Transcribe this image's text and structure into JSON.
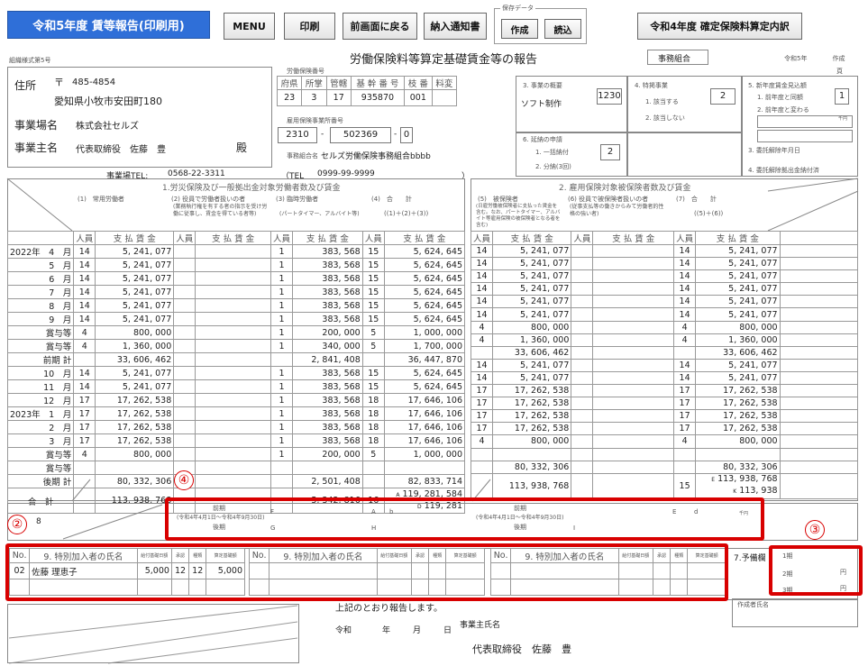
{
  "toolbar": {
    "title": "令和5年度 賃等報告(印刷用)",
    "menu": "MENU",
    "print": "印刷",
    "back": "前画面に戻る",
    "notice": "納入通知書",
    "save_group": "保存データ",
    "create": "作成",
    "load": "読込",
    "prev_year": "令和4年度 確定保険料算定内訳"
  },
  "header": {
    "form_no": "組織様式第5号",
    "doc_title": "労働保険料等算定基礎賃金等の報告",
    "jimu_kumiai": "事務組合",
    "created": "令和5年　　　　作成",
    "page": "頁"
  },
  "address": {
    "label_addr": "住所",
    "postal_mark": "〒",
    "postal": "485-4854",
    "addr": "愛知県小牧市安田町180",
    "label_office": "事業場名",
    "office": "株式会社セルズ",
    "label_owner": "事業主名",
    "owner": "代表取締役　佐藤　豊",
    "dono": "殿",
    "tel_label": "事業場TEL:",
    "tel": "0568-22-3311"
  },
  "insurance": {
    "label": "労働保険番号",
    "headers": [
      "府県",
      "所掌",
      "管轄",
      "基 幹 番 号",
      "枝 番",
      "",
      "番",
      "料変"
    ],
    "values": [
      "23",
      "3",
      "17",
      "935870",
      "001",
      "",
      "",
      ""
    ],
    "emp_label": "雇用保険事業所番号",
    "emp1": "2310",
    "emp2": "502369",
    "emp3": "0",
    "union_label": "事務組合名",
    "union": "セルズ労働保険事務組合bbbb",
    "tel_open": "（TEL",
    "union_tel": "0999-99-9999",
    "tel_close": "）"
  },
  "summary": {
    "gaiyo_label": "3. 事業の概要",
    "gaiyo_text": "ソフト制作",
    "gaiyo_code": "1230",
    "tokusho_label": "4. 特掲事業",
    "tokusho_1": "1. 該当する",
    "tokusho_2": "2. 該当しない",
    "tokusho_val": "2",
    "shinnen_label": "5. 新年度賃金見込額",
    "shinnen_1": "1. 前年度と同額",
    "shinnen_2": "2. 前年度と変わる",
    "shinnen_val": "1",
    "yen": "千円",
    "enno_label": "6. 延納の申請",
    "enno_1": "1. 一括納付",
    "enno_2": "2. 分納(3回)",
    "enno_val": "2",
    "kaijo_label": "3. 委託解除年月日",
    "kaijo2_label": "4. 委託解除拠出金納付済"
  },
  "section_left_title": "1.労災保険及び一般拠出金対象労働者数及び賃金",
  "section_right_title": "2. 雇用保険対象被保険者数及び賃金",
  "columns": {
    "c1": "(1)　常用労働者",
    "c2": "(2) 役員で労働者扱いの者",
    "c2sub": "(業務執行権を有する者の指示を受け労働に従事し、賃金を得ている者等)",
    "c3": "(3) 臨時労働者",
    "c3sub": "(パートタイマー、アルバイト等)",
    "c4": "(4)　合　　計",
    "c4sub": "((1)＋(2)＋(3))",
    "c5": "(5)　被保険者",
    "c5sub": "(日雇労働被保険者に支払った賃金を含む。なお、パートタイマー、アルバイト等雇用保険の被保険者となる者を含む)",
    "c6": "(6) 役員で被保険者扱いの者",
    "c6sub": "(従事支払等の働きからみて労働者的性格の強い者)",
    "c7": "(7)　合　　計",
    "c7sub": "((5)＋(6))",
    "ninzu": "人員",
    "shiharai": "支 払 賃 金",
    "yen_unit": "円"
  },
  "rows": [
    {
      "label": "2022年　4　月",
      "c1n": "14",
      "c1": "5, 241, 077",
      "c3n": "1",
      "c3": "383, 568",
      "c4n": "15",
      "c4": "5, 624, 645",
      "c5n": "14",
      "c5": "5, 241, 077",
      "c7n": "14",
      "c7": "5, 241, 077"
    },
    {
      "label": "5　月",
      "c1n": "14",
      "c1": "5, 241, 077",
      "c3n": "1",
      "c3": "383, 568",
      "c4n": "15",
      "c4": "5, 624, 645",
      "c5n": "14",
      "c5": "5, 241, 077",
      "c7n": "14",
      "c7": "5, 241, 077"
    },
    {
      "label": "6　月",
      "c1n": "14",
      "c1": "5, 241, 077",
      "c3n": "1",
      "c3": "383, 568",
      "c4n": "15",
      "c4": "5, 624, 645",
      "c5n": "14",
      "c5": "5, 241, 077",
      "c7n": "14",
      "c7": "5, 241, 077"
    },
    {
      "label": "7　月",
      "c1n": "14",
      "c1": "5, 241, 077",
      "c3n": "1",
      "c3": "383, 568",
      "c4n": "15",
      "c4": "5, 624, 645",
      "c5n": "14",
      "c5": "5, 241, 077",
      "c7n": "14",
      "c7": "5, 241, 077"
    },
    {
      "label": "8　月",
      "c1n": "14",
      "c1": "5, 241, 077",
      "c3n": "1",
      "c3": "383, 568",
      "c4n": "15",
      "c4": "5, 624, 645",
      "c5n": "14",
      "c5": "5, 241, 077",
      "c7n": "14",
      "c7": "5, 241, 077"
    },
    {
      "label": "9　月",
      "c1n": "14",
      "c1": "5, 241, 077",
      "c3n": "1",
      "c3": "383, 568",
      "c4n": "15",
      "c4": "5, 624, 645",
      "c5n": "14",
      "c5": "5, 241, 077",
      "c7n": "14",
      "c7": "5, 241, 077"
    },
    {
      "label": "賞与等",
      "c1n": "4",
      "c1": "800, 000",
      "c3n": "1",
      "c3": "200, 000",
      "c4n": "5",
      "c4": "1, 000, 000",
      "c5n": "4",
      "c5": "800, 000",
      "c7n": "4",
      "c7": "800, 000"
    },
    {
      "label": "賞与等",
      "c1n": "4",
      "c1": "1, 360, 000",
      "c3n": "1",
      "c3": "340, 000",
      "c4n": "5",
      "c4": "1, 700, 000",
      "c5n": "4",
      "c5": "1, 360, 000",
      "c7n": "4",
      "c7": "1, 360, 000"
    },
    {
      "label": "前期 計",
      "c1n": "",
      "c1": "33, 606, 462",
      "c3n": "",
      "c3": "2, 841, 408",
      "c4n": "",
      "c4": "36, 447, 870",
      "c5n": "",
      "c5": "33, 606, 462",
      "c7n": "",
      "c7": "33, 606, 462"
    },
    {
      "label": "10　月",
      "c1n": "14",
      "c1": "5, 241, 077",
      "c3n": "1",
      "c3": "383, 568",
      "c4n": "15",
      "c4": "5, 624, 645",
      "c5n": "14",
      "c5": "5, 241, 077",
      "c7n": "14",
      "c7": "5, 241, 077"
    },
    {
      "label": "11　月",
      "c1n": "14",
      "c1": "5, 241, 077",
      "c3n": "1",
      "c3": "383, 568",
      "c4n": "15",
      "c4": "5, 624, 645",
      "c5n": "14",
      "c5": "5, 241, 077",
      "c7n": "14",
      "c7": "5, 241, 077"
    },
    {
      "label": "12　月",
      "c1n": "17",
      "c1": "17, 262, 538",
      "c3n": "1",
      "c3": "383, 568",
      "c4n": "18",
      "c4": "17, 646, 106",
      "c5n": "17",
      "c5": "17, 262, 538",
      "c7n": "17",
      "c7": "17, 262, 538"
    },
    {
      "label": "2023年　1　月",
      "c1n": "17",
      "c1": "17, 262, 538",
      "c3n": "1",
      "c3": "383, 568",
      "c4n": "18",
      "c4": "17, 646, 106",
      "c5n": "17",
      "c5": "17, 262, 538",
      "c7n": "17",
      "c7": "17, 262, 538"
    },
    {
      "label": "2　月",
      "c1n": "17",
      "c1": "17, 262, 538",
      "c3n": "1",
      "c3": "383, 568",
      "c4n": "18",
      "c4": "17, 646, 106",
      "c5n": "17",
      "c5": "17, 262, 538",
      "c7n": "17",
      "c7": "17, 262, 538"
    },
    {
      "label": "3　月",
      "c1n": "17",
      "c1": "17, 262, 538",
      "c3n": "1",
      "c3": "383, 568",
      "c4n": "18",
      "c4": "17, 646, 106",
      "c5n": "17",
      "c5": "17, 262, 538",
      "c7n": "17",
      "c7": "17, 262, 538"
    },
    {
      "label": "賞与等",
      "c1n": "4",
      "c1": "800, 000",
      "c3n": "1",
      "c3": "200, 000",
      "c4n": "5",
      "c4": "1, 000, 000",
      "c5n": "4",
      "c5": "800, 000",
      "c7n": "4",
      "c7": "800, 000"
    },
    {
      "label": "賞与等",
      "c1n": "",
      "c1": "",
      "c3n": "",
      "c3": "",
      "c4n": "",
      "c4": "",
      "c5n": "",
      "c5": "",
      "c7n": "",
      "c7": ""
    },
    {
      "label": "後期 計",
      "c1n": "",
      "c1": "80, 332, 306",
      "c3n": "",
      "c3": "2, 501, 408",
      "c4n": "",
      "c4": "82, 833, 714",
      "c5n": "",
      "c5": "80, 332, 306",
      "c7n": "",
      "c7": "80, 332, 306"
    }
  ],
  "totals": {
    "label": "合　計",
    "c1": "113, 938, 768",
    "c3": "5, 342, 816",
    "c4a_mark": "A",
    "c4a": "119, 281, 584",
    "c4b": "16",
    "c4b_mark": "D",
    "c4c": "119, 281",
    "c5": "113, 938, 768",
    "c7a_mark": "E",
    "c7a": "113, 938, 768",
    "c7b": "15",
    "c7b_mark": "K",
    "c7c": "113, 938"
  },
  "row8": {
    "label": "8",
    "zenki": "前期",
    "zenki_sub": "(令和4年4月1日～令和4年9月30日)",
    "koki": "後期",
    "zenki_r": "前期",
    "zenki_r_sub": "(令和4年4月1日～令和4年9月30日)",
    "koki_r": "後期",
    "mark_f": "F",
    "mark_a": "A",
    "mark_b": "b",
    "mark_g": "G",
    "mark_h": "H",
    "mark_i": "I",
    "mark_e": "E",
    "mark_d": "d",
    "yen": "千円"
  },
  "special": {
    "no": "No.",
    "name_label": "9. 特別加入者の氏名",
    "base": "給付基礎日額",
    "approve": "承認",
    "kind": "種類",
    "amount": "算定基礎額",
    "row_no": "02",
    "row_name": "佐藤 理恵子",
    "row_base": "5,000",
    "row_a": "12",
    "row_b": "12",
    "row_amount": "5,000"
  },
  "yobi": {
    "label": "7.予備欄",
    "p1": "1期",
    "p2": "2期",
    "p3": "3期",
    "yen": "円"
  },
  "footer": {
    "report": "上記のとおり報告します。",
    "reiwa": "令和",
    "nen": "年",
    "tsuki": "月",
    "hi": "日",
    "owner_label": "事業主氏名",
    "owner": "代表取締役　佐藤　豊",
    "creator": "作成者氏名"
  },
  "badges": [
    "④",
    "②",
    "③"
  ]
}
